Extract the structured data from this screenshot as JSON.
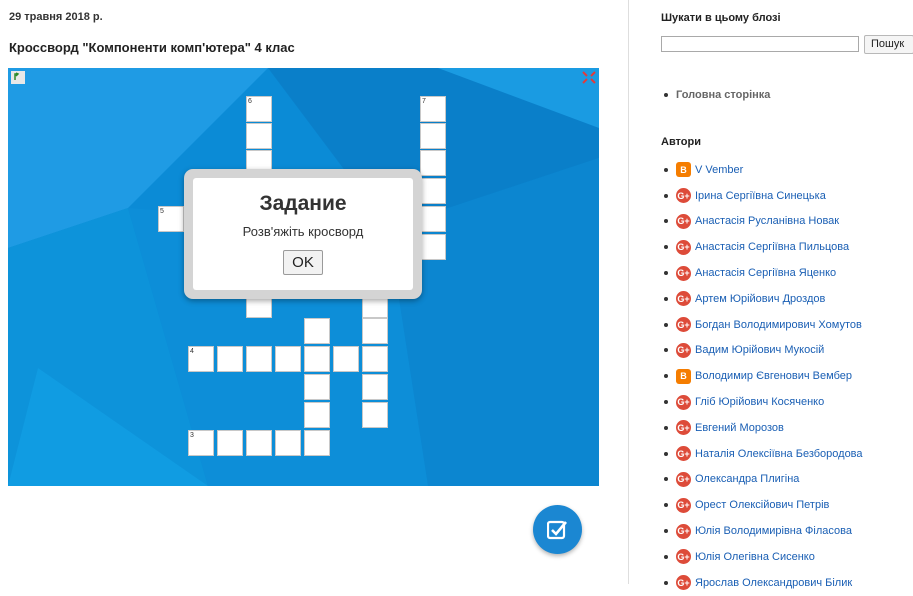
{
  "post": {
    "date": "29 травня 2018 р.",
    "title": "Кроссворд \"Компоненти комп'ютера\" 4 клас"
  },
  "crossword": {
    "clue_numbers": [
      "6",
      "7",
      "5",
      "4",
      "3"
    ],
    "dialog": {
      "title": "Задание",
      "text": "Розв'яжіть кросворд",
      "ok_label": "OK"
    }
  },
  "sidebar": {
    "search_heading": "Шукати в цьому блозі",
    "search_button": "Пошук",
    "search_value": "",
    "home_link": "Головна сторінка",
    "authors_heading": "Автори",
    "authors": [
      {
        "name": "V Vember",
        "icon": "blogger-icon"
      },
      {
        "name": "Ірина Сергіївна Синецька",
        "icon": "google-plus-icon"
      },
      {
        "name": "Анастасія Русланівна Новак",
        "icon": "google-plus-icon"
      },
      {
        "name": "Анастасія Сергіївна Пильцова",
        "icon": "google-plus-icon"
      },
      {
        "name": "Анастасія Сергіївна Яценко",
        "icon": "google-plus-icon"
      },
      {
        "name": "Артем Юрійович Дроздов",
        "icon": "google-plus-icon"
      },
      {
        "name": "Богдан Володимирович Хомутов",
        "icon": "google-plus-icon"
      },
      {
        "name": "Вадим Юрійович Мукосій",
        "icon": "google-plus-icon"
      },
      {
        "name": "Володимир Євгенович Вембер",
        "icon": "blogger-icon"
      },
      {
        "name": "Гліб Юрійович Косяченко",
        "icon": "google-plus-icon"
      },
      {
        "name": "Евгений Морозов",
        "icon": "google-plus-icon"
      },
      {
        "name": "Наталія Олексіївна Безбородова",
        "icon": "google-plus-icon"
      },
      {
        "name": "Олександра Плигіна",
        "icon": "google-plus-icon"
      },
      {
        "name": "Орест Олексійович Петрів",
        "icon": "google-plus-icon"
      },
      {
        "name": "Юлія Володимирівна Філасова",
        "icon": "google-plus-icon"
      },
      {
        "name": "Юлія Олегівна Сисенко",
        "icon": "google-plus-icon"
      },
      {
        "name": "Ярослав Олександрович Білик",
        "icon": "google-plus-icon"
      }
    ]
  },
  "colors": {
    "embed_background": "#0b8bd6",
    "link": "#1a5fb4",
    "google_plus": "#dd4b39",
    "blogger": "#f57d00",
    "fab": "#1b87d2"
  }
}
